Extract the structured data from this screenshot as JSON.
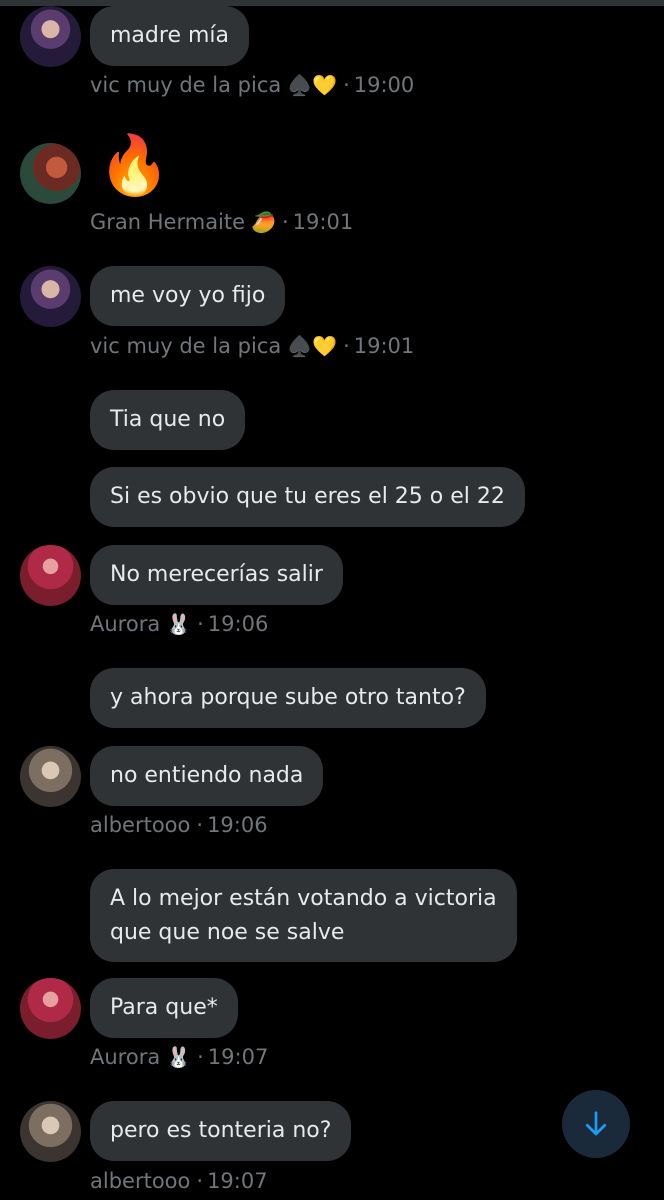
{
  "messages": [
    {
      "text": "madre mía"
    },
    {
      "emoji": "🔥"
    },
    {
      "text": "me voy yo fijo"
    },
    {
      "text": "Tia que no"
    },
    {
      "text": "Si es obvio que tu eres el 25 o el 22"
    },
    {
      "text": "No merecerías salir"
    },
    {
      "text": "y ahora porque sube otro tanto?"
    },
    {
      "text": "no entiendo nada"
    },
    {
      "lines": [
        "A lo mejor están votando a victoria",
        "que que noe se salve"
      ]
    },
    {
      "text": "Para que*"
    },
    {
      "text": "pero es tonteria no?"
    }
  ],
  "meta": [
    {
      "name": "vic muy de la pica",
      "emoji": "♠️💛",
      "time": "19:00"
    },
    {
      "name": "Gran Hermaite",
      "emoji": "🥭",
      "time": "19:01"
    },
    {
      "name": "vic muy de la pica",
      "emoji": "♠️💛",
      "time": "19:01"
    },
    {
      "name": "Aurora",
      "emoji": "🐰",
      "time": "19:06"
    },
    {
      "name": "albertooo",
      "emoji": "",
      "time": "19:06"
    },
    {
      "name": "Aurora",
      "emoji": "🐰",
      "time": "19:07"
    },
    {
      "name": "albertooo",
      "emoji": "",
      "time": "19:07"
    }
  ],
  "separator": "·",
  "icons": {
    "scroll_down": "arrow-down-icon"
  },
  "colors": {
    "bubble": "#2f3336",
    "text": "#e7e9ea",
    "meta": "#71767b",
    "accent": "#1d9bf0",
    "background": "#000000"
  }
}
